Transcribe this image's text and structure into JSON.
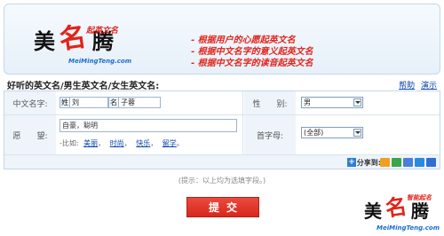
{
  "banner": {
    "logo": {
      "mei": "美",
      "ming": "名",
      "teng": "腾",
      "tagline": "起英文名",
      "url": "MeiMingTeng.com"
    },
    "features": [
      "- 根据用户的心愿起英文名",
      "- 根据中文名字的意义起英文名",
      "- 根据中文名字的读音起英文名"
    ]
  },
  "form": {
    "title": "好听的英文名/男生英文名/女生英文名:",
    "help_label": "帮助",
    "demo_label": "演示",
    "chinese_name": {
      "label": "中文名字:",
      "surname_prefix": "姓",
      "surname_value": "刘",
      "given_prefix": "名",
      "given_value": "子蓉"
    },
    "gender": {
      "label": "性　　别:",
      "value": "男"
    },
    "wish": {
      "label": "愿　　望:",
      "value": "自豪，聪明",
      "examples_prefix": "-比如:",
      "examples": [
        "美丽",
        "时尚",
        "快乐",
        "留学"
      ],
      "examples_suffix": "。"
    },
    "initial": {
      "label": "首字母:",
      "value": "(全部)"
    }
  },
  "share": {
    "label": "分享到:",
    "colors": [
      "#f0a020",
      "#3aa54a",
      "#4b7ed6",
      "#2a8ae0",
      "#2f6fd0"
    ]
  },
  "tip": "(提示：以上均为选填字段。)",
  "submit_label": "提交",
  "bottom_logo": {
    "mei": "美",
    "ming": "名",
    "teng": "腾",
    "tagline": "智能起名",
    "url": "MeiMingTeng.com"
  }
}
